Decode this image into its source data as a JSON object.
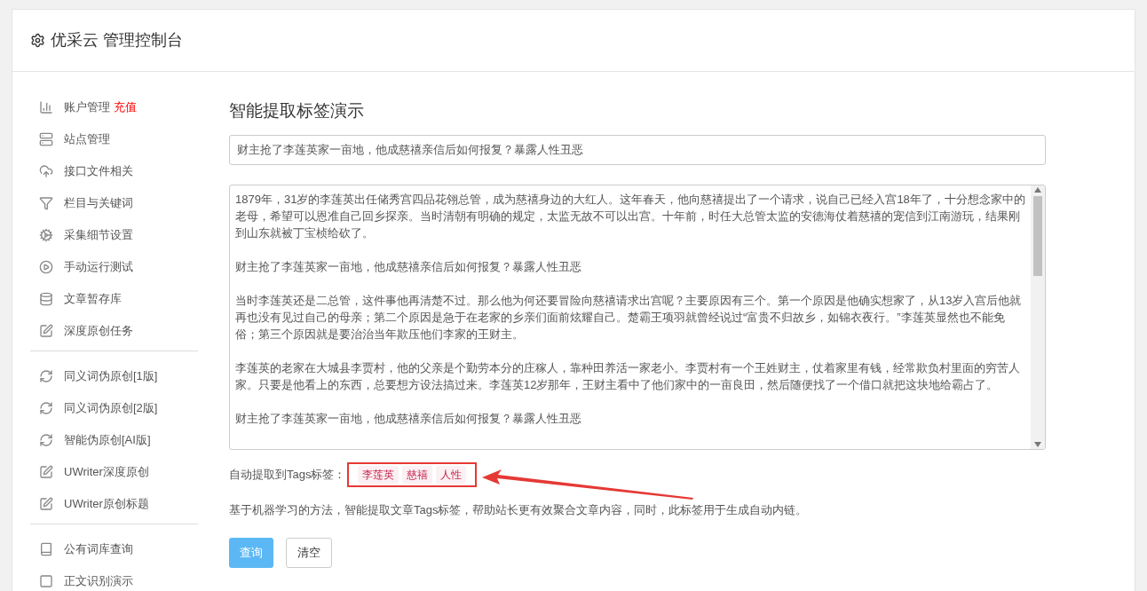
{
  "header": {
    "title": "优采云 管理控制台"
  },
  "sidebar": {
    "groups": [
      {
        "items": [
          {
            "label": "账户管理",
            "badge": "充值"
          },
          {
            "label": "站点管理"
          },
          {
            "label": "接口文件相关"
          },
          {
            "label": "栏目与关键词"
          },
          {
            "label": "采集细节设置"
          },
          {
            "label": "手动运行测试"
          },
          {
            "label": "文章暂存库"
          },
          {
            "label": "深度原创任务"
          }
        ]
      },
      {
        "items": [
          {
            "label": "同义词伪原创[1版]"
          },
          {
            "label": "同义词伪原创[2版]"
          },
          {
            "label": "智能伪原创[AI版]"
          },
          {
            "label": "UWriter深度原创"
          },
          {
            "label": "UWriter原创标题"
          }
        ]
      },
      {
        "items": [
          {
            "label": "公有词库查询"
          },
          {
            "label": "正文识别演示"
          }
        ]
      }
    ]
  },
  "main": {
    "heading": "智能提取标签演示",
    "title_field": {
      "value": "财主抢了李莲英家一亩地，他成慈禧亲信后如何报复？暴露人性丑恶"
    },
    "content_field": {
      "paragraphs": [
        "1879年，31岁的李莲英出任储秀宫四品花翎总管，成为慈禧身边的大红人。这年春天，他向慈禧提出了一个请求，说自己已经入宫18年了，十分想念家中的老母，希望可以恩准自己回乡探亲。当时清朝有明确的规定，太监无故不可以出宫。十年前，时任大总管太监的安德海仗着慈禧的宠信到江南游玩，结果刚到山东就被丁宝桢给砍了。",
        "财主抢了李莲英家一亩地，他成慈禧亲信后如何报复？暴露人性丑恶",
        "当时李莲英还是二总管，这件事他再清楚不过。那么他为何还要冒险向慈禧请求出宫呢？主要原因有三个。第一个原因是他确实想家了，从13岁入宫后他就再也没有见过自己的母亲；第二个原因是急于在老家的乡亲们面前炫耀自己。楚霸王项羽就曾经说过“富贵不归故乡，如锦衣夜行。”李莲英显然也不能免俗；第三个原因就是要治治当年欺压他们李家的王财主。",
        "李莲英的老家在大城县李贾村，他的父亲是个勤劳本分的庄稼人，靠种田养活一家老小。李贾村有一个王姓财主，仗着家里有钱，经常欺负村里面的穷苦人家。只要是他看上的东西，总要想方设法搞过来。李莲英12岁那年，王财主看中了他们家中的一亩良田，然后随便找了一个借口就把这块地给霸占了。",
        "财主抢了李莲英家一亩地，他成慈禧亲信后如何报复？暴露人性丑恶"
      ]
    },
    "tags_label": "自动提取到Tags标签：",
    "tags": [
      "李莲英",
      "慈禧",
      "人性"
    ],
    "description": "基于机器学习的方法，智能提取文章Tags标签，帮助站长更有效聚合文章内容，同时，此标签用于生成自动内链。",
    "buttons": [
      {
        "label": "查询",
        "kind": "primary"
      },
      {
        "label": "清空",
        "kind": "default"
      }
    ]
  }
}
